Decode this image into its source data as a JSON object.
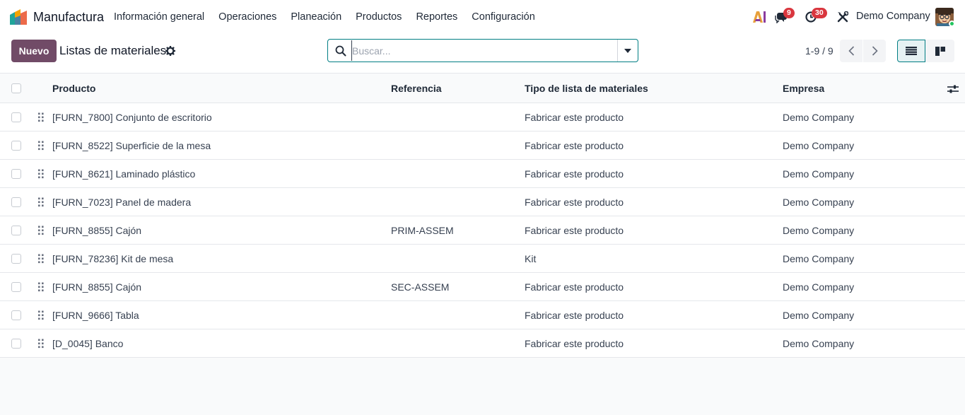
{
  "navbar": {
    "app_name": "Manufactura",
    "menu": [
      "Información general",
      "Operaciones",
      "Planeación",
      "Productos",
      "Reportes",
      "Configuración"
    ],
    "messages_count": "9",
    "activities_count": "30",
    "company": "Demo Company"
  },
  "control": {
    "new_label": "Nuevo",
    "title": "Listas de materiales",
    "search_placeholder": "Buscar...",
    "pager": "1-9 / 9"
  },
  "table": {
    "columns": [
      "Producto",
      "Referencia",
      "Tipo de lista de materiales",
      "Empresa"
    ],
    "rows": [
      {
        "product": "[FURN_7800] Conjunto de escritorio",
        "reference": "",
        "type": "Fabricar este producto",
        "company": "Demo Company"
      },
      {
        "product": "[FURN_8522] Superficie de la mesa",
        "reference": "",
        "type": "Fabricar este producto",
        "company": "Demo Company"
      },
      {
        "product": "[FURN_8621] Laminado plástico",
        "reference": "",
        "type": "Fabricar este producto",
        "company": "Demo Company"
      },
      {
        "product": "[FURN_7023] Panel de madera",
        "reference": "",
        "type": "Fabricar este producto",
        "company": "Demo Company"
      },
      {
        "product": "[FURN_8855] Cajón",
        "reference": "PRIM-ASSEM",
        "type": "Fabricar este producto",
        "company": "Demo Company"
      },
      {
        "product": "[FURN_78236] Kit de mesa",
        "reference": "",
        "type": "Kit",
        "company": "Demo Company"
      },
      {
        "product": "[FURN_8855] Cajón",
        "reference": "SEC-ASSEM",
        "type": "Fabricar este producto",
        "company": "Demo Company"
      },
      {
        "product": "[FURN_9666] Tabla",
        "reference": "",
        "type": "Fabricar este producto",
        "company": "Demo Company"
      },
      {
        "product": "[D_0045] Banco",
        "reference": "",
        "type": "Fabricar este producto",
        "company": "Demo Company"
      }
    ]
  },
  "colors": {
    "brand": "#714b67",
    "accent": "#017e84",
    "badge": "#d9363e"
  }
}
